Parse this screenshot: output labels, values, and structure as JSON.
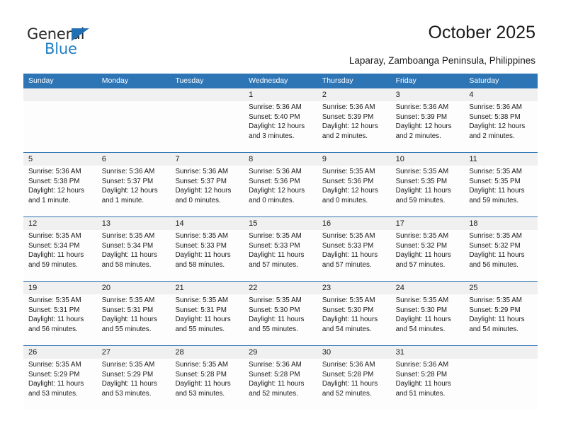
{
  "brand": {
    "name_top": "General",
    "name_bottom": "Blue",
    "triangle_color": "#1f6fb5",
    "blue_text_color": "#1f7ec4"
  },
  "header": {
    "title": "October 2025",
    "subtitle": "Laparay, Zamboanga Peninsula, Philippines"
  },
  "theme": {
    "header_bar_color": "#2e75b6",
    "date_band_color": "#f0f0f0",
    "row_rule_color": "#2e75b6"
  },
  "weekdays": [
    "Sunday",
    "Monday",
    "Tuesday",
    "Wednesday",
    "Thursday",
    "Friday",
    "Saturday"
  ],
  "weeks": [
    [
      {
        "day": "",
        "sunrise": "",
        "sunset": "",
        "daylight_a": "",
        "daylight_b": ""
      },
      {
        "day": "",
        "sunrise": "",
        "sunset": "",
        "daylight_a": "",
        "daylight_b": ""
      },
      {
        "day": "",
        "sunrise": "",
        "sunset": "",
        "daylight_a": "",
        "daylight_b": ""
      },
      {
        "day": "1",
        "sunrise": "Sunrise: 5:36 AM",
        "sunset": "Sunset: 5:40 PM",
        "daylight_a": "Daylight: 12 hours",
        "daylight_b": "and 3 minutes."
      },
      {
        "day": "2",
        "sunrise": "Sunrise: 5:36 AM",
        "sunset": "Sunset: 5:39 PM",
        "daylight_a": "Daylight: 12 hours",
        "daylight_b": "and 2 minutes."
      },
      {
        "day": "3",
        "sunrise": "Sunrise: 5:36 AM",
        "sunset": "Sunset: 5:39 PM",
        "daylight_a": "Daylight: 12 hours",
        "daylight_b": "and 2 minutes."
      },
      {
        "day": "4",
        "sunrise": "Sunrise: 5:36 AM",
        "sunset": "Sunset: 5:38 PM",
        "daylight_a": "Daylight: 12 hours",
        "daylight_b": "and 2 minutes."
      }
    ],
    [
      {
        "day": "5",
        "sunrise": "Sunrise: 5:36 AM",
        "sunset": "Sunset: 5:38 PM",
        "daylight_a": "Daylight: 12 hours",
        "daylight_b": "and 1 minute."
      },
      {
        "day": "6",
        "sunrise": "Sunrise: 5:36 AM",
        "sunset": "Sunset: 5:37 PM",
        "daylight_a": "Daylight: 12 hours",
        "daylight_b": "and 1 minute."
      },
      {
        "day": "7",
        "sunrise": "Sunrise: 5:36 AM",
        "sunset": "Sunset: 5:37 PM",
        "daylight_a": "Daylight: 12 hours",
        "daylight_b": "and 0 minutes."
      },
      {
        "day": "8",
        "sunrise": "Sunrise: 5:36 AM",
        "sunset": "Sunset: 5:36 PM",
        "daylight_a": "Daylight: 12 hours",
        "daylight_b": "and 0 minutes."
      },
      {
        "day": "9",
        "sunrise": "Sunrise: 5:35 AM",
        "sunset": "Sunset: 5:36 PM",
        "daylight_a": "Daylight: 12 hours",
        "daylight_b": "and 0 minutes."
      },
      {
        "day": "10",
        "sunrise": "Sunrise: 5:35 AM",
        "sunset": "Sunset: 5:35 PM",
        "daylight_a": "Daylight: 11 hours",
        "daylight_b": "and 59 minutes."
      },
      {
        "day": "11",
        "sunrise": "Sunrise: 5:35 AM",
        "sunset": "Sunset: 5:35 PM",
        "daylight_a": "Daylight: 11 hours",
        "daylight_b": "and 59 minutes."
      }
    ],
    [
      {
        "day": "12",
        "sunrise": "Sunrise: 5:35 AM",
        "sunset": "Sunset: 5:34 PM",
        "daylight_a": "Daylight: 11 hours",
        "daylight_b": "and 59 minutes."
      },
      {
        "day": "13",
        "sunrise": "Sunrise: 5:35 AM",
        "sunset": "Sunset: 5:34 PM",
        "daylight_a": "Daylight: 11 hours",
        "daylight_b": "and 58 minutes."
      },
      {
        "day": "14",
        "sunrise": "Sunrise: 5:35 AM",
        "sunset": "Sunset: 5:33 PM",
        "daylight_a": "Daylight: 11 hours",
        "daylight_b": "and 58 minutes."
      },
      {
        "day": "15",
        "sunrise": "Sunrise: 5:35 AM",
        "sunset": "Sunset: 5:33 PM",
        "daylight_a": "Daylight: 11 hours",
        "daylight_b": "and 57 minutes."
      },
      {
        "day": "16",
        "sunrise": "Sunrise: 5:35 AM",
        "sunset": "Sunset: 5:33 PM",
        "daylight_a": "Daylight: 11 hours",
        "daylight_b": "and 57 minutes."
      },
      {
        "day": "17",
        "sunrise": "Sunrise: 5:35 AM",
        "sunset": "Sunset: 5:32 PM",
        "daylight_a": "Daylight: 11 hours",
        "daylight_b": "and 57 minutes."
      },
      {
        "day": "18",
        "sunrise": "Sunrise: 5:35 AM",
        "sunset": "Sunset: 5:32 PM",
        "daylight_a": "Daylight: 11 hours",
        "daylight_b": "and 56 minutes."
      }
    ],
    [
      {
        "day": "19",
        "sunrise": "Sunrise: 5:35 AM",
        "sunset": "Sunset: 5:31 PM",
        "daylight_a": "Daylight: 11 hours",
        "daylight_b": "and 56 minutes."
      },
      {
        "day": "20",
        "sunrise": "Sunrise: 5:35 AM",
        "sunset": "Sunset: 5:31 PM",
        "daylight_a": "Daylight: 11 hours",
        "daylight_b": "and 55 minutes."
      },
      {
        "day": "21",
        "sunrise": "Sunrise: 5:35 AM",
        "sunset": "Sunset: 5:31 PM",
        "daylight_a": "Daylight: 11 hours",
        "daylight_b": "and 55 minutes."
      },
      {
        "day": "22",
        "sunrise": "Sunrise: 5:35 AM",
        "sunset": "Sunset: 5:30 PM",
        "daylight_a": "Daylight: 11 hours",
        "daylight_b": "and 55 minutes."
      },
      {
        "day": "23",
        "sunrise": "Sunrise: 5:35 AM",
        "sunset": "Sunset: 5:30 PM",
        "daylight_a": "Daylight: 11 hours",
        "daylight_b": "and 54 minutes."
      },
      {
        "day": "24",
        "sunrise": "Sunrise: 5:35 AM",
        "sunset": "Sunset: 5:30 PM",
        "daylight_a": "Daylight: 11 hours",
        "daylight_b": "and 54 minutes."
      },
      {
        "day": "25",
        "sunrise": "Sunrise: 5:35 AM",
        "sunset": "Sunset: 5:29 PM",
        "daylight_a": "Daylight: 11 hours",
        "daylight_b": "and 54 minutes."
      }
    ],
    [
      {
        "day": "26",
        "sunrise": "Sunrise: 5:35 AM",
        "sunset": "Sunset: 5:29 PM",
        "daylight_a": "Daylight: 11 hours",
        "daylight_b": "and 53 minutes."
      },
      {
        "day": "27",
        "sunrise": "Sunrise: 5:35 AM",
        "sunset": "Sunset: 5:29 PM",
        "daylight_a": "Daylight: 11 hours",
        "daylight_b": "and 53 minutes."
      },
      {
        "day": "28",
        "sunrise": "Sunrise: 5:35 AM",
        "sunset": "Sunset: 5:28 PM",
        "daylight_a": "Daylight: 11 hours",
        "daylight_b": "and 53 minutes."
      },
      {
        "day": "29",
        "sunrise": "Sunrise: 5:36 AM",
        "sunset": "Sunset: 5:28 PM",
        "daylight_a": "Daylight: 11 hours",
        "daylight_b": "and 52 minutes."
      },
      {
        "day": "30",
        "sunrise": "Sunrise: 5:36 AM",
        "sunset": "Sunset: 5:28 PM",
        "daylight_a": "Daylight: 11 hours",
        "daylight_b": "and 52 minutes."
      },
      {
        "day": "31",
        "sunrise": "Sunrise: 5:36 AM",
        "sunset": "Sunset: 5:28 PM",
        "daylight_a": "Daylight: 11 hours",
        "daylight_b": "and 51 minutes."
      },
      {
        "day": "",
        "sunrise": "",
        "sunset": "",
        "daylight_a": "",
        "daylight_b": ""
      }
    ]
  ]
}
